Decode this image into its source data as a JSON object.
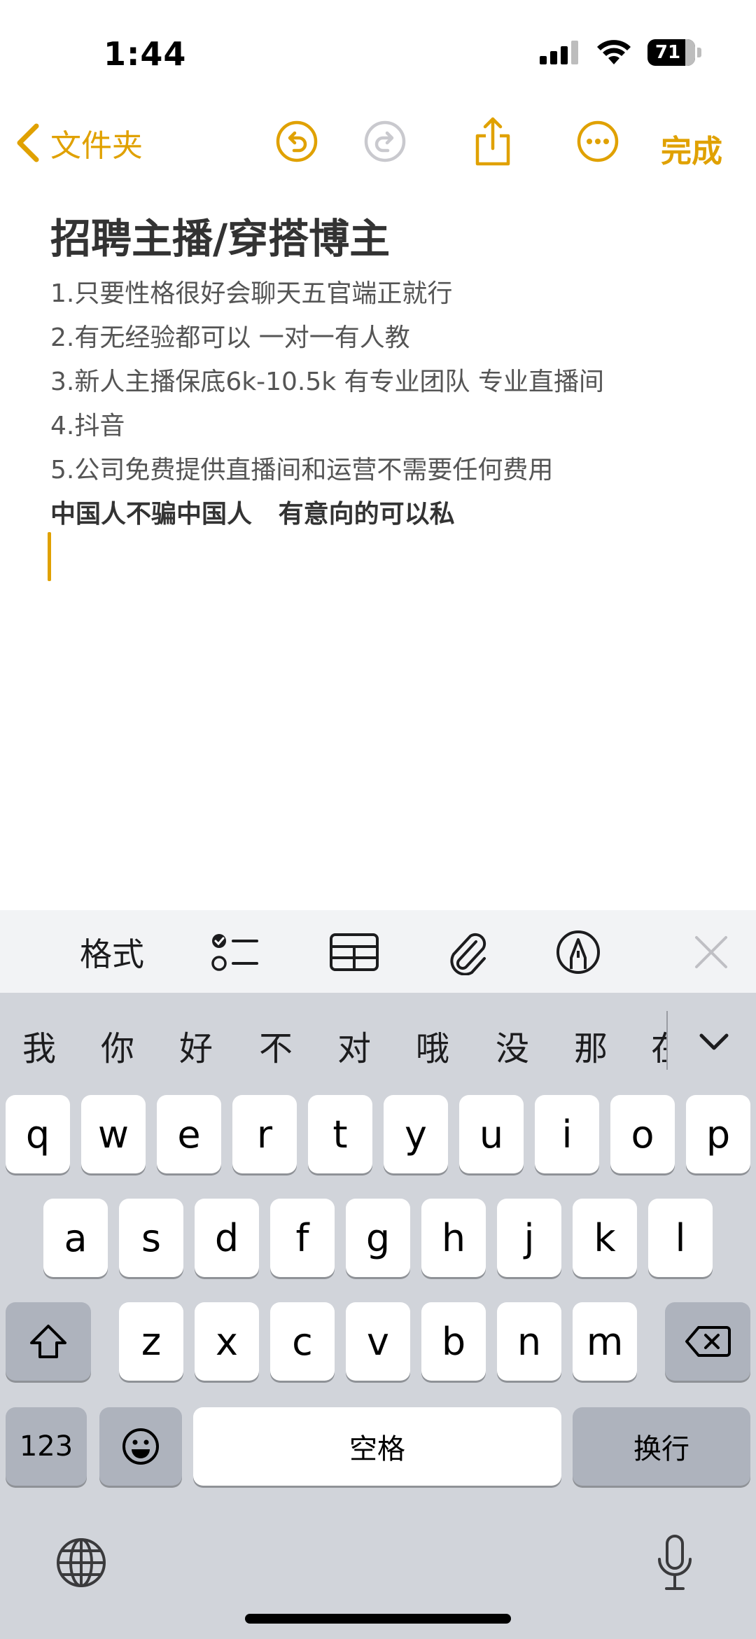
{
  "status_bar": {
    "time": "1:44",
    "battery": "71"
  },
  "nav": {
    "back_label": "文件夹",
    "done_label": "完成"
  },
  "note": {
    "title": "招聘主播/穿搭博主",
    "lines": [
      "1.只要性格很好会聊天五官端正就行",
      "2.有无经验都可以 一对一有人教",
      "3.新人主播保底6k-10.5k 有专业团队 专业直播间",
      "4.抖音",
      "5.公司免费提供直播间和运营不需要任何费用"
    ],
    "bold_line": "中国人不骗中国人   有意向的可以私"
  },
  "format_toolbar": {
    "format_label": "格式"
  },
  "keyboard": {
    "candidates": [
      "我",
      "你",
      "好",
      "不",
      "对",
      "哦",
      "没",
      "那",
      "在"
    ],
    "row1": [
      "q",
      "w",
      "e",
      "r",
      "t",
      "y",
      "u",
      "i",
      "o",
      "p"
    ],
    "row2": [
      "a",
      "s",
      "d",
      "f",
      "g",
      "h",
      "j",
      "k",
      "l"
    ],
    "row3": [
      "z",
      "x",
      "c",
      "v",
      "b",
      "n",
      "m"
    ],
    "numbers_label": "123",
    "space_label": "空格",
    "return_label": "换行"
  },
  "colors": {
    "accent": "#e0a100",
    "keyboard_bg": "#d1d4da",
    "dark_key": "#aeb3bd"
  }
}
